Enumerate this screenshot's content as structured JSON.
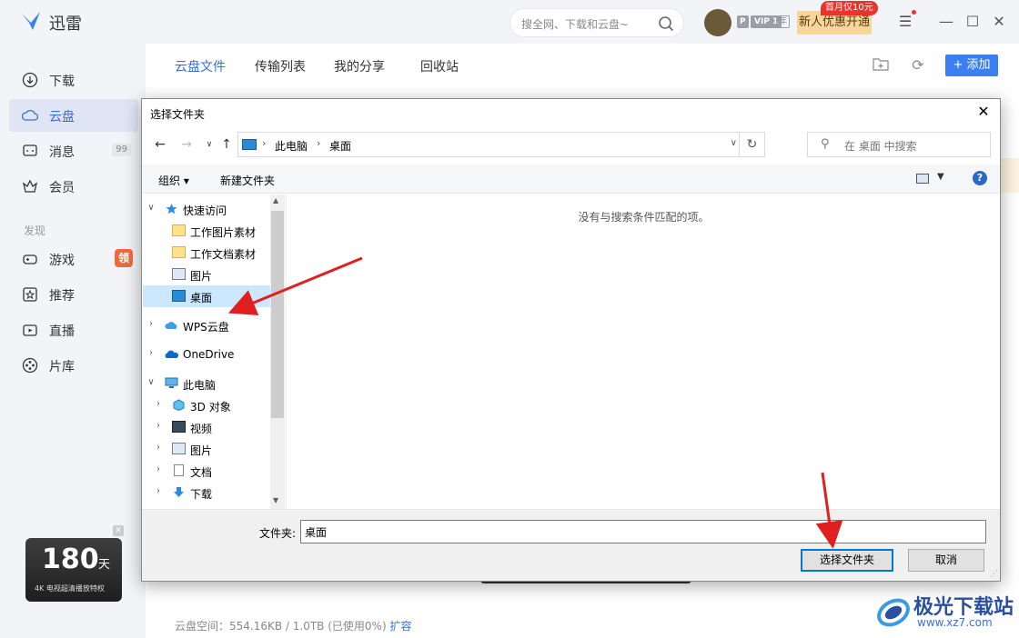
{
  "app": {
    "title": "迅雷",
    "search_placeholder": "搜全网、下载和云盘~",
    "promo_tag": "首月仅10元",
    "promo_label": "新人优惠开通",
    "badge_p": "P",
    "badge_vip": "VIP 1",
    "badge_year": "年"
  },
  "sidebar": {
    "items": [
      {
        "label": "下载"
      },
      {
        "label": "云盘"
      },
      {
        "label": "消息",
        "count": "99"
      },
      {
        "label": "会员"
      }
    ],
    "section": "发现",
    "discover": [
      {
        "label": "游戏",
        "hot": "领"
      },
      {
        "label": "推荐"
      },
      {
        "label": "直播"
      },
      {
        "label": "片库"
      }
    ],
    "promo_days": "180",
    "promo_unit": "天",
    "promo_sub": "4K 电视超清播放特权"
  },
  "cloud": {
    "tabs": [
      "云盘文件",
      "传输列表",
      "我的分享",
      "回收站"
    ],
    "add_label": "+ 添加",
    "footer_text": "云盘空间：554.16KB / 1.0TB (已使用0%)",
    "footer_link": "扩容"
  },
  "dialog": {
    "title": "选择文件夹",
    "breadcrumb": [
      "此电脑",
      "桌面"
    ],
    "search_placeholder": "在 桌面 中搜索",
    "organize": "组织 ▾",
    "new_folder": "新建文件夹",
    "empty_message": "没有与搜索条件匹配的项。",
    "tree": [
      {
        "label": "快速访问",
        "level": 0,
        "expanded": true
      },
      {
        "label": "工作图片素材",
        "level": 1
      },
      {
        "label": "工作文档素材",
        "level": 1
      },
      {
        "label": "图片",
        "level": 1
      },
      {
        "label": "桌面",
        "level": 1,
        "selected": true
      },
      {
        "label": "WPS云盘",
        "level": 0
      },
      {
        "label": "OneDrive",
        "level": 0
      },
      {
        "label": "此电脑",
        "level": 0,
        "expanded": true
      },
      {
        "label": "3D 对象",
        "level": 1
      },
      {
        "label": "视频",
        "level": 1
      },
      {
        "label": "图片",
        "level": 1
      },
      {
        "label": "文档",
        "level": 1
      },
      {
        "label": "下载",
        "level": 1
      }
    ],
    "folder_label": "文件夹:",
    "folder_value": "桌面",
    "select_button": "选择文件夹",
    "cancel_button": "取消"
  },
  "watermark": {
    "title": "极光下载站",
    "url": "www.xz7.com"
  },
  "colors": {
    "accent": "#3b6fd8",
    "selection": "#cce8ff",
    "arrow": "#e02020"
  }
}
